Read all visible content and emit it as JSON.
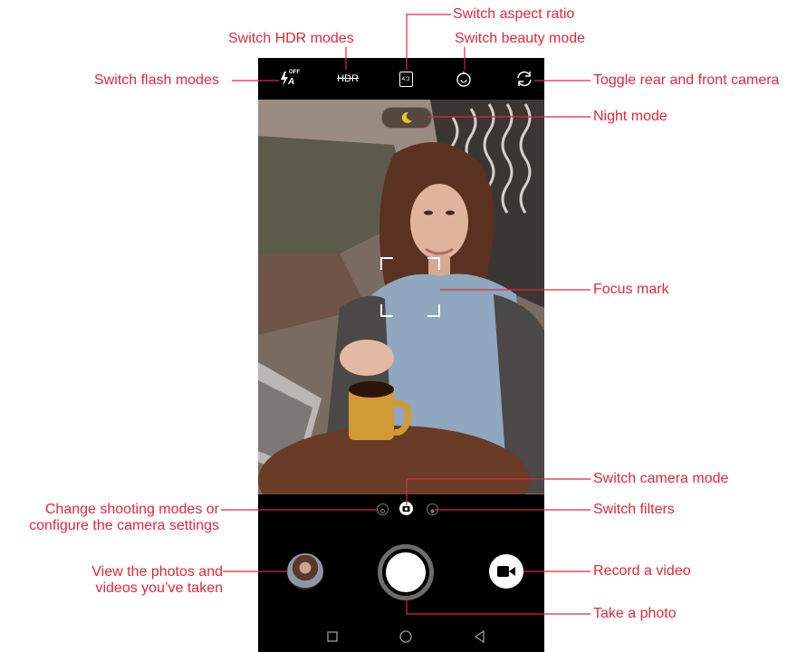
{
  "callouts": {
    "switch_aspect_ratio": "Switch aspect ratio",
    "switch_hdr_modes": "Switch HDR modes",
    "switch_beauty_mode": "Switch beauty mode",
    "switch_flash_modes": "Switch flash modes",
    "toggle_camera": "Toggle rear and front camera",
    "night_mode": "Night mode",
    "focus_mark": "Focus mark",
    "switch_camera_mode": "Switch camera mode",
    "change_shooting_modes_line1": "Change shooting modes or",
    "change_shooting_modes_line2": "configure the camera settings",
    "switch_filters": "Switch filters",
    "view_photos_line1": "View the photos and",
    "view_photos_line2": "videos you’ve taken",
    "record_video": "Record a video",
    "take_photo": "Take a photo"
  },
  "topbar": {
    "flash_state": "OFF",
    "flash_mode": "A",
    "hdr_label": "HDR",
    "aspect_ratio": "4:3"
  },
  "colors": {
    "callout": "#e0283a",
    "night_moon": "#f5c518",
    "phone_bg": "#000000"
  },
  "icons": [
    "flash-icon",
    "hdr-icon",
    "aspect-ratio-icon",
    "beauty-icon",
    "switch-camera-icon",
    "moon-icon",
    "settings-icon",
    "camera-mode-icon",
    "filter-icon",
    "gallery-thumbnail",
    "shutter-button",
    "video-icon",
    "recent-apps-icon",
    "home-icon",
    "back-icon"
  ]
}
